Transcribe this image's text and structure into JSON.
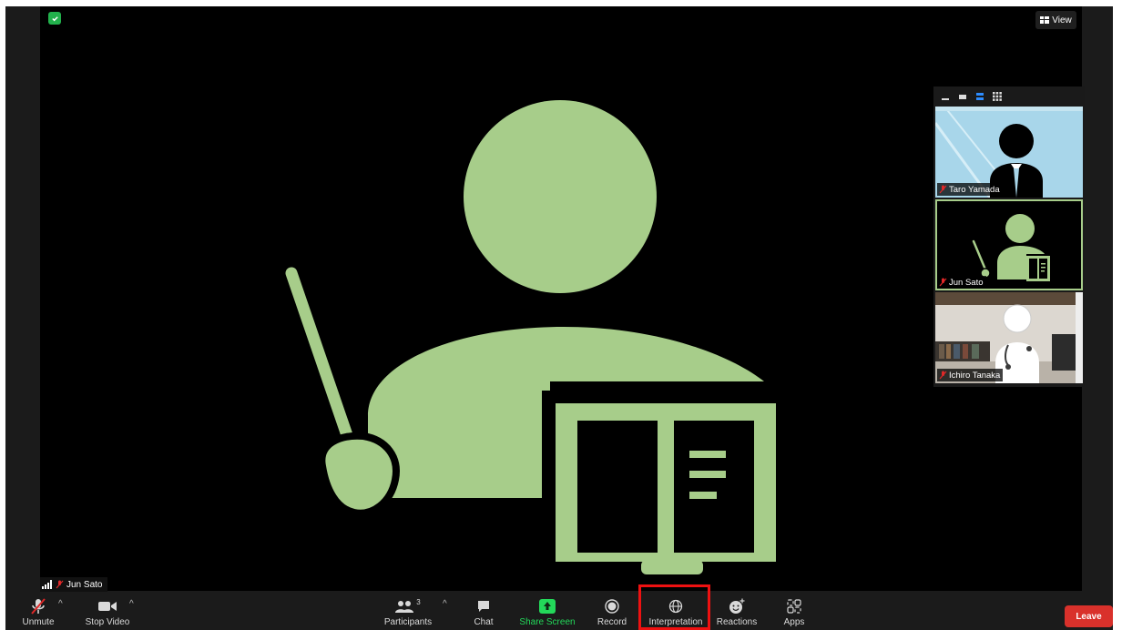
{
  "view_button": {
    "label": "View"
  },
  "active_speaker": {
    "name": "Jun Sato"
  },
  "gallery": {
    "tiles": [
      {
        "name": "Taro Yamada"
      },
      {
        "name": "Jun Sato"
      },
      {
        "name": "Ichiro Tanaka"
      }
    ]
  },
  "toolbar": {
    "unmute": "Unmute",
    "stop_video": "Stop Video",
    "participants": "Participants",
    "participants_count": "3",
    "chat": "Chat",
    "share_screen": "Share Screen",
    "record": "Record",
    "interpretation": "Interpretation",
    "reactions": "Reactions",
    "apps": "Apps",
    "leave": "Leave"
  },
  "colors": {
    "avatar_green": "#a7cd8a",
    "share_green": "#23d95a",
    "leave_red": "#d9312b",
    "highlight_red": "#e11111"
  }
}
